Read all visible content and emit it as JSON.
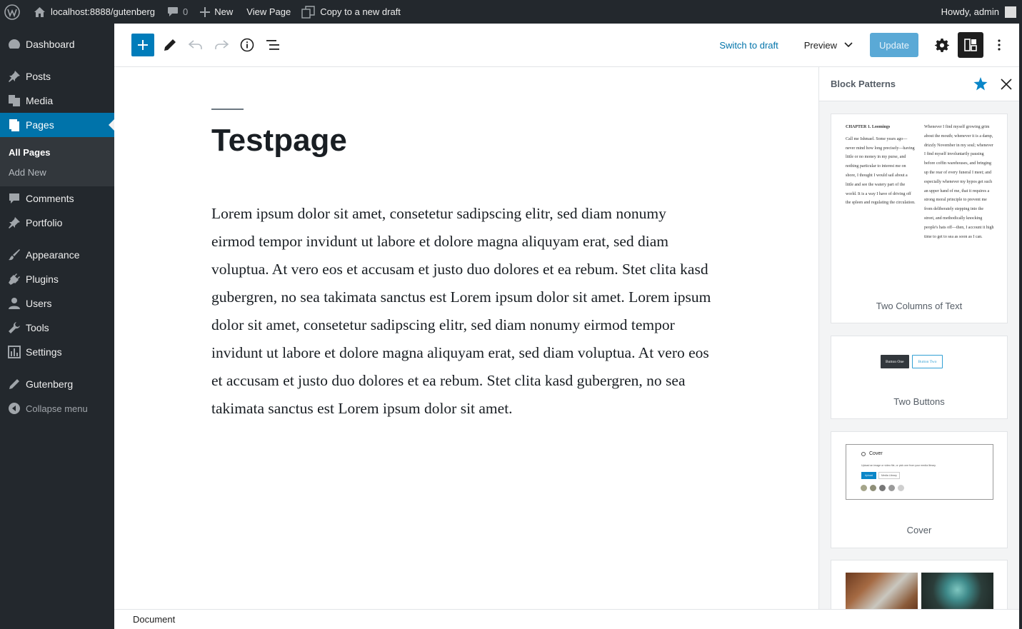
{
  "adminbar": {
    "site": "localhost:8888/gutenberg",
    "comments_count": "0",
    "new_label": "New",
    "view_page": "View Page",
    "copy_draft": "Copy to a new draft",
    "howdy": "Howdy, admin"
  },
  "sidebar": {
    "dashboard": "Dashboard",
    "posts": "Posts",
    "media": "Media",
    "pages": "Pages",
    "all_pages": "All Pages",
    "add_new": "Add New",
    "comments": "Comments",
    "portfolio": "Portfolio",
    "appearance": "Appearance",
    "plugins": "Plugins",
    "users": "Users",
    "tools": "Tools",
    "settings": "Settings",
    "gutenberg": "Gutenberg",
    "collapse": "Collapse menu"
  },
  "header": {
    "switch_to_draft": "Switch to draft",
    "preview": "Preview",
    "update": "Update"
  },
  "post": {
    "title": "Testpage",
    "body": "Lorem ipsum dolor sit amet, consetetur sadipscing elitr, sed diam nonumy eirmod tempor invidunt ut labore et dolore magna aliquyam erat, sed diam voluptua. At vero eos et accusam et justo duo dolores et ea rebum. Stet clita kasd gubergren, no sea takimata sanctus est Lorem ipsum dolor sit amet. Lorem ipsum dolor sit amet, consetetur sadipscing elitr, sed diam nonumy eirmod tempor invidunt ut labore et dolore magna aliquyam erat, sed diam voluptua. At vero eos et accusam et justo duo dolores et ea rebum. Stet clita kasd gubergren, no sea takimata sanctus est Lorem ipsum dolor sit amet."
  },
  "panel": {
    "title": "Block Patterns",
    "patterns": {
      "two_columns": {
        "label": "Two Columns of Text",
        "col1_heading": "CHAPTER 1. Loomings",
        "col1_text": "Call me Ishmael. Some years ago—never mind how long precisely—having little or no money in my purse, and nothing particular to interest me on shore, I thought I would sail about a little and see the watery part of the world. It is a way I have of driving off the spleen and regulating the circulation.",
        "col2_text": "Whenever I find myself growing grim about the mouth; whenever it is a damp, drizzly November in my soul; whenever I find myself involuntarily pausing before coffin warehouses, and bringing up the rear of every funeral I meet; and especially whenever my hypos get such an upper hand of me, that it requires a strong moral principle to prevent me from deliberately stepping into the street, and methodically knocking people's hats off—then, I account it high time to get to sea as soon as I can."
      },
      "two_buttons": {
        "label": "Two Buttons",
        "button_one": "Button One",
        "button_two": "Button Two"
      },
      "cover": {
        "label": "Cover",
        "block_title": "Cover",
        "instructions": "Upload an image or video file, or pick one from your media library.",
        "upload": "Upload",
        "media_library": "Media Library",
        "swatch_colors": [
          "#a5a58a",
          "#8f8f78",
          "#777777",
          "#9a9a9a",
          "#cfcfcf"
        ]
      }
    }
  },
  "footer": {
    "breadcrumb": "Document"
  },
  "colors": {
    "accent": "#007cba",
    "admin_dark": "#23282d",
    "admin_current": "#0073aa",
    "star": "#0a86c8"
  }
}
